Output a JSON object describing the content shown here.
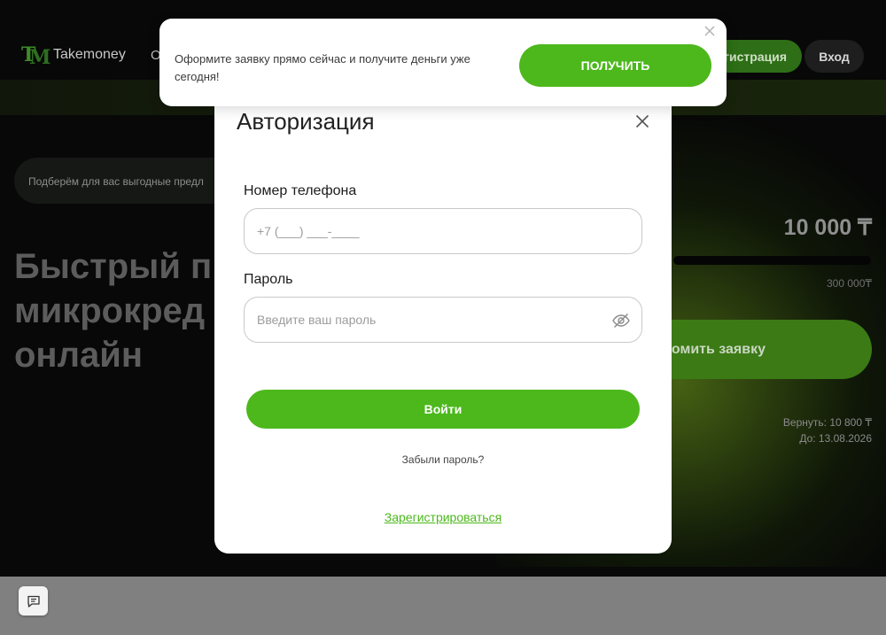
{
  "header": {
    "logo_text": "Takemoney",
    "nav_partial": "О",
    "register_label": "егистрация",
    "login_label": "Вход"
  },
  "hero": {
    "promo_pill": "Подберём для вас выгодные предл",
    "headline_line1": "Быстрый п",
    "headline_line2": "микрокред",
    "headline_line3": "онлайн"
  },
  "calculator": {
    "amount": "10 000 ₸",
    "slider_value_fraction": 0.0,
    "max_amount": "300 000₸",
    "apply_label": "омить заявку",
    "return_amount": "Вернуть: 10 800 ₸",
    "return_date": "До: 13.08.2026"
  },
  "popup": {
    "text": "Оформите заявку прямо сейчас и получите деньги уже сегодня!",
    "button_label": "ПОЛУЧИТЬ"
  },
  "auth_modal": {
    "title": "Авторизация",
    "phone_label": "Номер телефона",
    "phone_placeholder": "+7 (___) ___-____",
    "password_label": "Пароль",
    "password_placeholder": "Введите ваш пароль",
    "submit_label": "Войти",
    "forgot_link": "Забыли пароль?",
    "register_link": "Зарегистрироваться"
  },
  "icons": {
    "close": "close-icon",
    "eye_off": "eye-off-icon",
    "chat": "chat-icon"
  },
  "colors": {
    "accent_green": "#4cb81c",
    "overlay": "#808080"
  }
}
